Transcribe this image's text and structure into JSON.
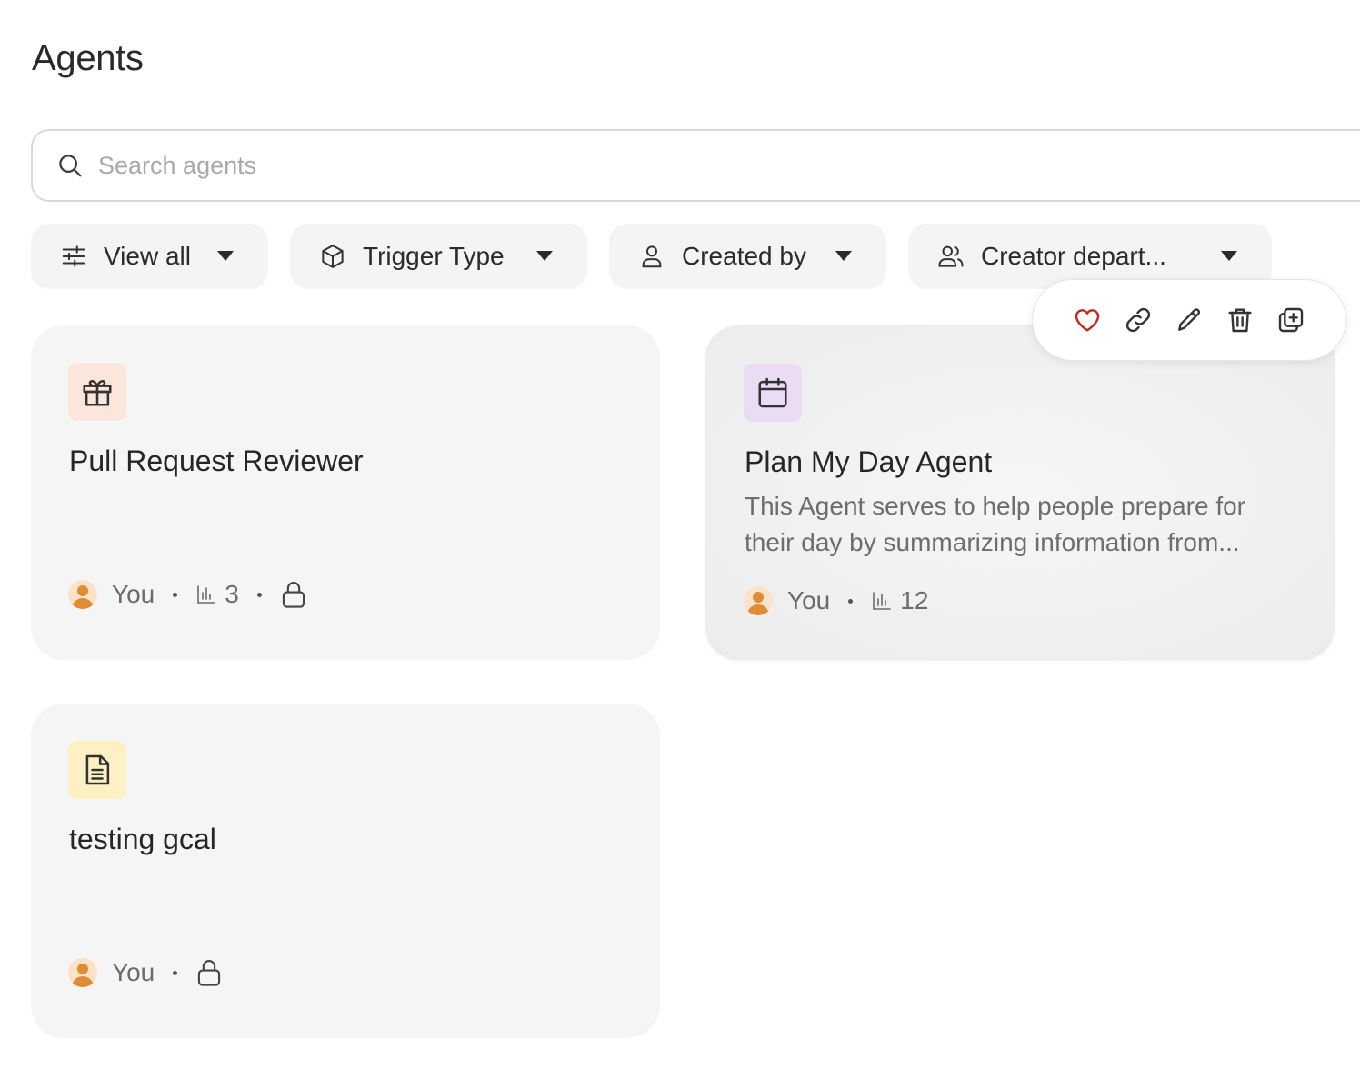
{
  "page": {
    "title": "Agents"
  },
  "search": {
    "placeholder": "Search agents",
    "value": ""
  },
  "filters": [
    {
      "label": "View all",
      "icon": "sliders-icon"
    },
    {
      "label": "Trigger Type",
      "icon": "cube-icon"
    },
    {
      "label": "Created by",
      "icon": "user-icon"
    },
    {
      "label": "Creator depart...",
      "icon": "users-icon"
    }
  ],
  "actions": [
    "heart-icon",
    "link-icon",
    "pencil-icon",
    "trash-icon",
    "duplicate-icon"
  ],
  "colors": {
    "heart": "#c0281d",
    "badge_gift": "#fbe6dc",
    "badge_calendar": "#ecdcf3",
    "badge_doc": "#fdf1c4"
  },
  "agents": [
    {
      "title": "Pull Request Reviewer",
      "description": "",
      "icon": "gift-icon",
      "creator": "You",
      "runs": "3",
      "private": true
    },
    {
      "title": "Plan My Day Agent",
      "description": "This Agent serves to help people prepare for their day by summarizing information from...",
      "icon": "calendar-icon",
      "creator": "You",
      "runs": "12",
      "private": false
    },
    {
      "title": "testing gcal",
      "description": "",
      "icon": "document-icon",
      "creator": "You",
      "runs": "",
      "private": true
    }
  ]
}
